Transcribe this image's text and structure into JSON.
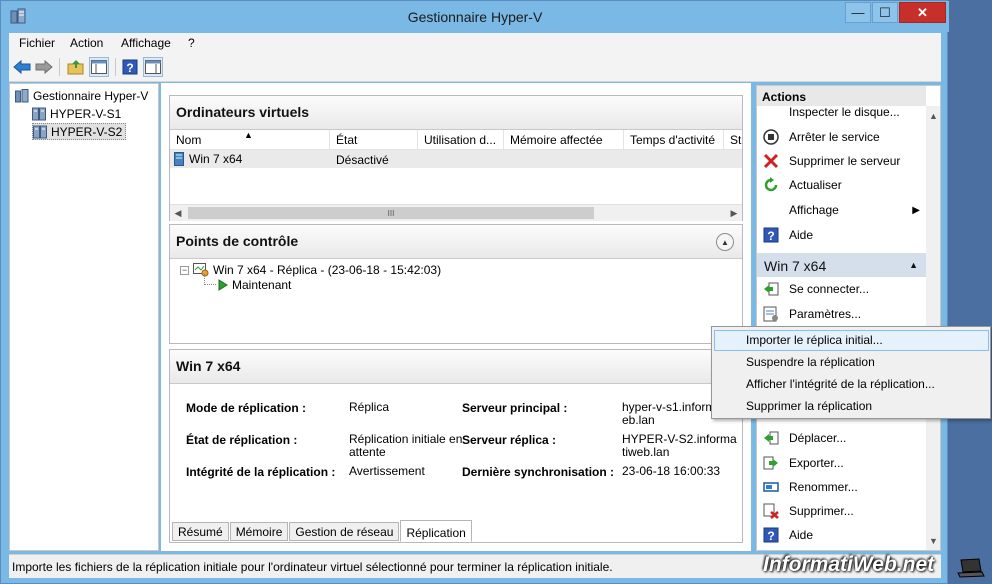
{
  "window": {
    "title": "Gestionnaire Hyper-V",
    "close_glyph": "✕",
    "min_glyph": "—",
    "max_glyph": "☐"
  },
  "menubar": {
    "items": [
      "Fichier",
      "Action",
      "Affichage",
      "?"
    ]
  },
  "toolbar": {
    "buttons": [
      "back-icon",
      "forward-icon",
      "up-folder-icon",
      "console-tree-icon",
      "help-icon",
      "action-pane-icon"
    ]
  },
  "tree": {
    "root": "Gestionnaire Hyper-V",
    "servers": [
      "HYPER-V-S1",
      "HYPER-V-S2"
    ],
    "selected": "HYPER-V-S2"
  },
  "vms_panel": {
    "title": "Ordinateurs virtuels",
    "columns": [
      "Nom",
      "État",
      "Utilisation d...",
      "Mémoire affectée",
      "Temps d'activité",
      "St"
    ],
    "rows": [
      {
        "name": "Win 7 x64",
        "state": "Désactivé"
      }
    ],
    "scroll_thumb": "III"
  },
  "checkpoints_panel": {
    "title": "Points de contrôle",
    "checkpoint": "Win 7 x64 - Réplica - (23-06-18 - 15:42:03)",
    "now": "Maintenant"
  },
  "details_panel": {
    "title": "Win 7 x64",
    "fields": {
      "mode_label": "Mode de réplication :",
      "mode_value": "Réplica",
      "state_label": "État de réplication :",
      "state_value_1": "Réplication initiale en",
      "state_value_2": "attente",
      "health_label": "Intégrité de la réplication :",
      "health_value": "Avertissement",
      "primary_label": "Serveur principal :",
      "primary_value_1": "hyper-v-s1.informati",
      "primary_value_2": "eb.lan",
      "replica_label": "Serveur réplica :",
      "replica_value_1": "HYPER-V-S2.informa",
      "replica_value_2": "tiweb.lan",
      "sync_label": "Dernière synchronisation :",
      "sync_value": "23-06-18 16:00:33"
    },
    "tabs": [
      "Résumé",
      "Mémoire",
      "Gestion de réseau",
      "Réplication"
    ],
    "active_tab": "Réplication"
  },
  "actions": {
    "header": "Actions",
    "server_items": [
      "Inspecter le disque...",
      "Arrêter le service",
      "Supprimer le serveur",
      "Actualiser",
      "Affichage",
      "Aide"
    ],
    "vm_group": "Win 7 x64",
    "vm_items": [
      "Se connecter...",
      "Paramètres...",
      "Déplacer...",
      "Exporter...",
      "Renommer...",
      "Supprimer...",
      "Aide"
    ]
  },
  "context_menu": {
    "items": [
      "Importer le réplica initial...",
      "Suspendre la réplication",
      "Afficher l'intégrité de la réplication...",
      "Supprimer la réplication"
    ],
    "highlighted": "Importer le réplica initial..."
  },
  "statusbar": {
    "text": "Importe les fichiers de la réplication initiale pour l'ordinateur virtuel sélectionné pour terminer la réplication initiale."
  },
  "watermark": {
    "text": "InformatiWeb.net"
  },
  "colors": {
    "title_bar": "#7ab8e6",
    "close_button": "#c7302a",
    "highlight": "#e5f1fb",
    "group_header": "#d4dfeb"
  }
}
